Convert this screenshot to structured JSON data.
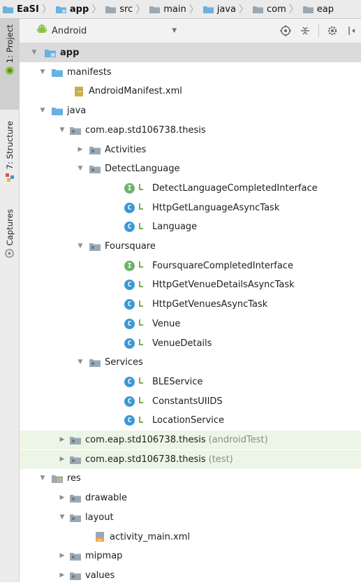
{
  "breadcrumb": [
    {
      "label": "EaSI",
      "bold": true
    },
    {
      "label": "app",
      "bold": true
    },
    {
      "label": "src",
      "bold": false
    },
    {
      "label": "main",
      "bold": false
    },
    {
      "label": "java",
      "bold": false
    },
    {
      "label": "com",
      "bold": false
    },
    {
      "label": "eap",
      "bold": false
    }
  ],
  "side_tabs": {
    "project": "1: Project",
    "structure": "7: Structure",
    "captures": "Captures"
  },
  "panel": {
    "view_label": "Android"
  },
  "tree": [
    {
      "label": "app",
      "depth": 0,
      "expanded": true,
      "icon": "module-folder-icon",
      "bold": true,
      "selected": true
    },
    {
      "label": "manifests",
      "depth": 1,
      "expanded": true,
      "icon": "folder-icon"
    },
    {
      "label": "AndroidManifest.xml",
      "depth": 2,
      "icon": "manifest-file-icon"
    },
    {
      "label": "java",
      "depth": 1,
      "expanded": true,
      "icon": "source-folder-icon"
    },
    {
      "label": "com.eap.std106738.thesis",
      "depth": 2,
      "expanded": true,
      "icon": "package-icon"
    },
    {
      "label": "Activities",
      "depth": 3,
      "expanded": false,
      "icon": "package-icon"
    },
    {
      "label": "DetectLanguage",
      "depth": 3,
      "expanded": true,
      "icon": "package-icon"
    },
    {
      "label": "DetectLanguageCompletedInterface",
      "depth": 4,
      "icon": "interface-icon"
    },
    {
      "label": "HttpGetLanguageAsyncTask",
      "depth": 4,
      "icon": "class-icon"
    },
    {
      "label": "Language",
      "depth": 4,
      "icon": "class-icon"
    },
    {
      "label": "Foursquare",
      "depth": 3,
      "expanded": true,
      "icon": "package-icon"
    },
    {
      "label": "FoursquareCompletedInterface",
      "depth": 4,
      "icon": "interface-icon"
    },
    {
      "label": "HttpGetVenueDetailsAsyncTask",
      "depth": 4,
      "icon": "class-icon"
    },
    {
      "label": "HttpGetVenuesAsyncTask",
      "depth": 4,
      "icon": "class-icon"
    },
    {
      "label": "Venue",
      "depth": 4,
      "icon": "class-icon"
    },
    {
      "label": "VenueDetails",
      "depth": 4,
      "icon": "class-icon"
    },
    {
      "label": "Services",
      "depth": 3,
      "expanded": true,
      "icon": "package-icon"
    },
    {
      "label": "BLEService",
      "depth": 4,
      "icon": "class-icon"
    },
    {
      "label": "ConstantsUIIDS",
      "depth": 4,
      "icon": "class-icon"
    },
    {
      "label": "LocationService",
      "depth": 4,
      "icon": "class-icon"
    },
    {
      "label": "com.eap.std106738.thesis",
      "suffix": "(androidTest)",
      "depth": 2,
      "expanded": false,
      "icon": "package-icon",
      "highlight": true
    },
    {
      "label": "com.eap.std106738.thesis",
      "suffix": "(test)",
      "depth": 2,
      "expanded": false,
      "icon": "package-icon",
      "highlight": true
    },
    {
      "label": "res",
      "depth": 1,
      "expanded": true,
      "icon": "resource-folder-icon"
    },
    {
      "label": "drawable",
      "depth": 2,
      "expanded": false,
      "icon": "package-icon"
    },
    {
      "label": "layout",
      "depth": 2,
      "expanded": true,
      "icon": "package-icon"
    },
    {
      "label": "activity_main.xml",
      "depth": 3,
      "icon": "layout-file-icon"
    },
    {
      "label": "mipmap",
      "depth": 2,
      "expanded": false,
      "icon": "package-icon"
    },
    {
      "label": "values",
      "depth": 2,
      "expanded": false,
      "icon": "package-icon"
    }
  ],
  "colors": {
    "class_badge": "#3b98d6",
    "interface_badge": "#6fb36a",
    "highlight_row": "#edf6e6",
    "selected_row": "#dbdbdb"
  }
}
